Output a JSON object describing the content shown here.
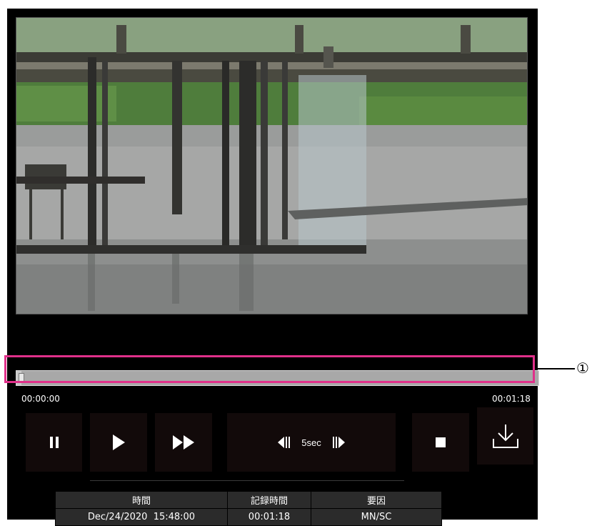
{
  "player": {
    "video": {
      "description_icon": "camera-video-frame"
    },
    "seek": {
      "progress_fraction": 0.01,
      "start_time": "00:00:00",
      "end_time": "00:01:18"
    },
    "callout_number": "①",
    "controls": {
      "pause_icon": "pause-icon",
      "play_icon": "play-icon",
      "fast_forward_icon": "fast-forward-icon",
      "skip_back_icon": "skip-back-icon",
      "skip_label": "5sec",
      "skip_forward_icon": "skip-forward-icon",
      "stop_icon": "stop-icon",
      "download_icon": "download-icon"
    },
    "info_table": {
      "headers": [
        "時間",
        "記録時間",
        "要因"
      ],
      "values": [
        "Dec/24/2020  15:48:00",
        "00:01:18",
        "MN/SC"
      ]
    }
  },
  "colors": {
    "player_bg": "#000000",
    "seek_highlight": "#e0308a",
    "button_bg": "#120a0a",
    "table_bg": "#2b2b2b"
  }
}
